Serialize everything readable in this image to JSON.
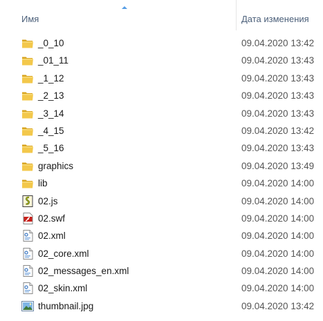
{
  "header": {
    "name_label": "Имя",
    "date_label": "Дата изменения"
  },
  "files": [
    {
      "name": "_0_10",
      "date": "09.04.2020 13:42",
      "icon": "folder-icon"
    },
    {
      "name": "_01_11",
      "date": "09.04.2020 13:43",
      "icon": "folder-icon"
    },
    {
      "name": "_1_12",
      "date": "09.04.2020 13:43",
      "icon": "folder-icon"
    },
    {
      "name": "_2_13",
      "date": "09.04.2020 13:43",
      "icon": "folder-icon"
    },
    {
      "name": "_3_14",
      "date": "09.04.2020 13:43",
      "icon": "folder-icon"
    },
    {
      "name": "_4_15",
      "date": "09.04.2020 13:42",
      "icon": "folder-icon"
    },
    {
      "name": "_5_16",
      "date": "09.04.2020 13:43",
      "icon": "folder-icon"
    },
    {
      "name": "graphics",
      "date": "09.04.2020 13:49",
      "icon": "folder-icon"
    },
    {
      "name": "lib",
      "date": "09.04.2020 14:00",
      "icon": "folder-icon"
    },
    {
      "name": "02.js",
      "date": "09.04.2020 14:00",
      "icon": "js-script-icon"
    },
    {
      "name": "02.swf",
      "date": "09.04.2020 14:00",
      "icon": "swf-file-icon"
    },
    {
      "name": "02.xml",
      "date": "09.04.2020 14:00",
      "icon": "xml-file-icon"
    },
    {
      "name": "02_core.xml",
      "date": "09.04.2020 14:00",
      "icon": "xml-file-icon"
    },
    {
      "name": "02_messages_en.xml",
      "date": "09.04.2020 14:00",
      "icon": "xml-file-icon"
    },
    {
      "name": "02_skin.xml",
      "date": "09.04.2020 14:00",
      "icon": "xml-file-icon"
    },
    {
      "name": "thumbnail.jpg",
      "date": "09.04.2020 13:42",
      "icon": "image-file-icon"
    }
  ],
  "colors": {
    "folder": "#e8b833",
    "header_text": "#4c607a",
    "sort_arrow": "#569de5"
  }
}
